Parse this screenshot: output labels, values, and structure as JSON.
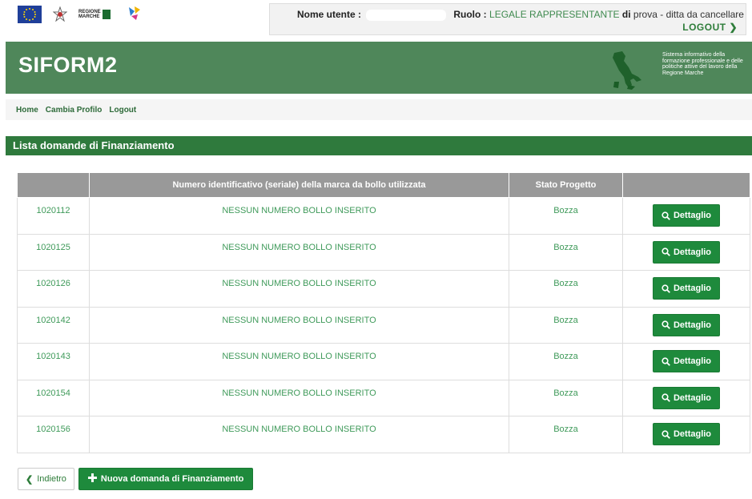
{
  "header": {
    "user_label": "Nome utente :",
    "role_label": "Ruolo :",
    "role_value": "LEGALE RAPPRESENTANTE",
    "di": "di",
    "org": "prova - ditta da cancellare",
    "logout": "LOGOUT",
    "logo_rm_line1": "REGIONE",
    "logo_rm_line2": "MARCHE",
    "brand": "SIFORM2",
    "system_desc": "Sistema informativo della formazione professionale e delle politiche attive del lavoro della Regione Marche"
  },
  "nav": {
    "home": "Home",
    "profile": "Cambia Profilo",
    "logout": "Logout"
  },
  "panel": {
    "title": "Lista domande di Finanziamento"
  },
  "table": {
    "columns": [
      "",
      "Numero identificativo (seriale) della marca da bollo utilizzata",
      "Stato Progetto",
      ""
    ],
    "rows": [
      {
        "id": "1020112",
        "bollo": "NESSUN NUMERO BOLLO INSERITO",
        "stato": "Bozza"
      },
      {
        "id": "1020125",
        "bollo": "NESSUN NUMERO BOLLO INSERITO",
        "stato": "Bozza"
      },
      {
        "id": "1020126",
        "bollo": "NESSUN NUMERO BOLLO INSERITO",
        "stato": "Bozza"
      },
      {
        "id": "1020142",
        "bollo": "NESSUN NUMERO BOLLO INSERITO",
        "stato": "Bozza"
      },
      {
        "id": "1020143",
        "bollo": "NESSUN NUMERO BOLLO INSERITO",
        "stato": "Bozza"
      },
      {
        "id": "1020154",
        "bollo": "NESSUN NUMERO BOLLO INSERITO",
        "stato": "Bozza"
      },
      {
        "id": "1020156",
        "bollo": "NESSUN NUMERO BOLLO INSERITO",
        "stato": "Bozza"
      }
    ],
    "detail_label": "Dettaglio"
  },
  "actions": {
    "back": "Indietro",
    "new": "Nuova domanda di Finanziamento"
  },
  "colors": {
    "brand_green": "#4f875a",
    "panel_green": "#2f7a3d",
    "button_green": "#1e8a3c",
    "text_green": "#3f9a5a"
  },
  "icons": {
    "detail": "search-icon",
    "back": "chevron-left-icon",
    "new": "plus-icon",
    "logout": "chevron-right-icon"
  }
}
